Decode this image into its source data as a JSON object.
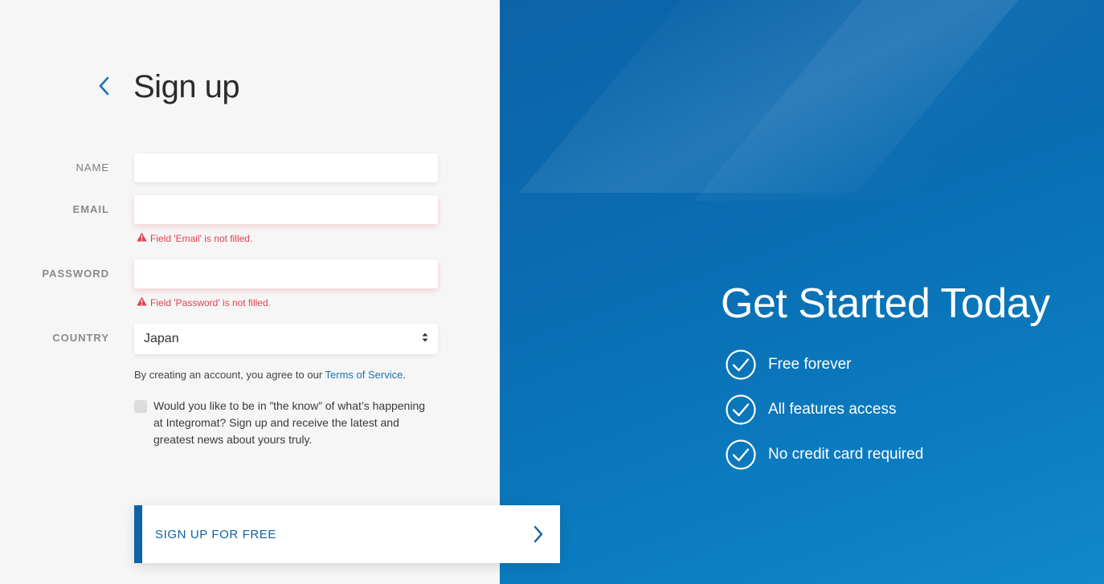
{
  "header": {
    "title": "Sign up",
    "back_icon": "chevron-left-icon"
  },
  "form": {
    "name": {
      "label": "NAME",
      "value": "",
      "placeholder": ""
    },
    "email": {
      "label": "EMAIL",
      "value": "",
      "placeholder": "",
      "error": "Field 'Email' is not filled."
    },
    "password": {
      "label": "PASSWORD",
      "value": "",
      "placeholder": "",
      "error": "Field 'Password' is not filled."
    },
    "country": {
      "label": "COUNTRY",
      "selected": "Japan"
    },
    "terms": {
      "prefix": "By creating an account, you agree to our ",
      "link": "Terms of Service",
      "suffix": "."
    },
    "newsletter": {
      "checked": false,
      "text": "Would you like to be in ”the know” of what’s happening at Integromat? Sign up and receive the latest and greatest news about yours truly."
    },
    "submit_label": "SIGN UP FOR FREE"
  },
  "hero": {
    "title": "Get Started Today",
    "benefits": [
      {
        "icon": "check-circle-icon",
        "text": "Free forever"
      },
      {
        "icon": "check-circle-icon",
        "text": "All features access"
      },
      {
        "icon": "check-circle-icon",
        "text": "No credit card required"
      }
    ]
  },
  "colors": {
    "accent": "#0c63a6",
    "error": "#e0424f",
    "link": "#1a73b5",
    "left_bg": "#f6f6f6",
    "right_bg": "#0a6db2"
  }
}
